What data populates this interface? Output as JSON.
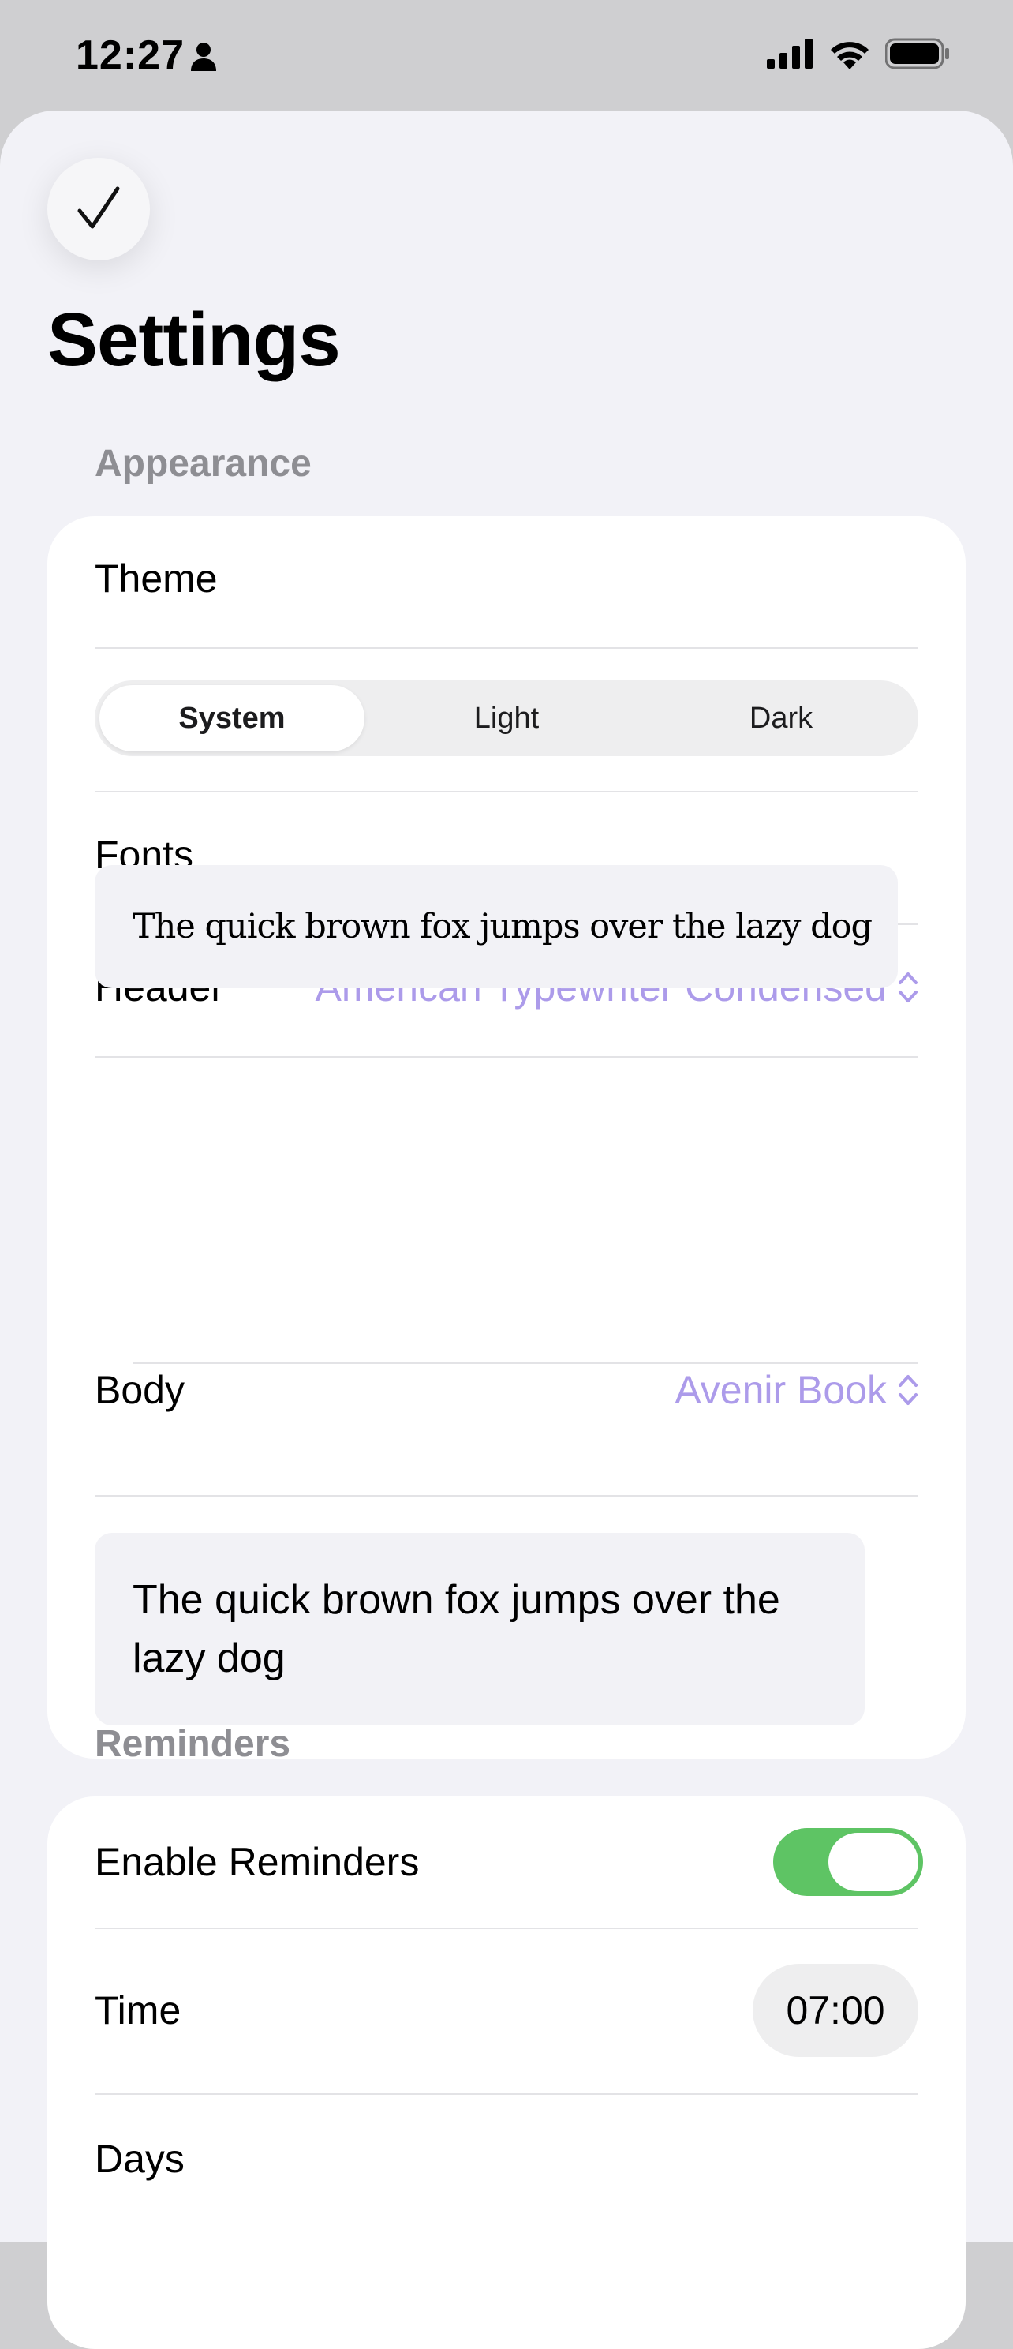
{
  "status_bar": {
    "time": "12:27"
  },
  "page": {
    "title": "Settings"
  },
  "appearance": {
    "section_title": "Appearance",
    "theme_label": "Theme",
    "theme_options": [
      "System",
      "Light",
      "Dark"
    ],
    "theme_selected": "System",
    "fonts_label": "Fonts",
    "header_label": "Header",
    "header_font": "American Typewriter Condensed",
    "header_sample": "The quick brown fox jumps over the lazy dog",
    "body_label": "Body",
    "body_font": "Avenir Book",
    "body_sample": "The quick brown fox jumps over the lazy dog"
  },
  "reminders": {
    "section_title": "Reminders",
    "enable_label": "Enable Reminders",
    "enabled": true,
    "time_label": "Time",
    "time_value": "07:00",
    "days_label": "Days"
  },
  "colors": {
    "accent": "#ac9bea",
    "toggle_on": "#5ec464",
    "background": "#f2f2f7"
  }
}
